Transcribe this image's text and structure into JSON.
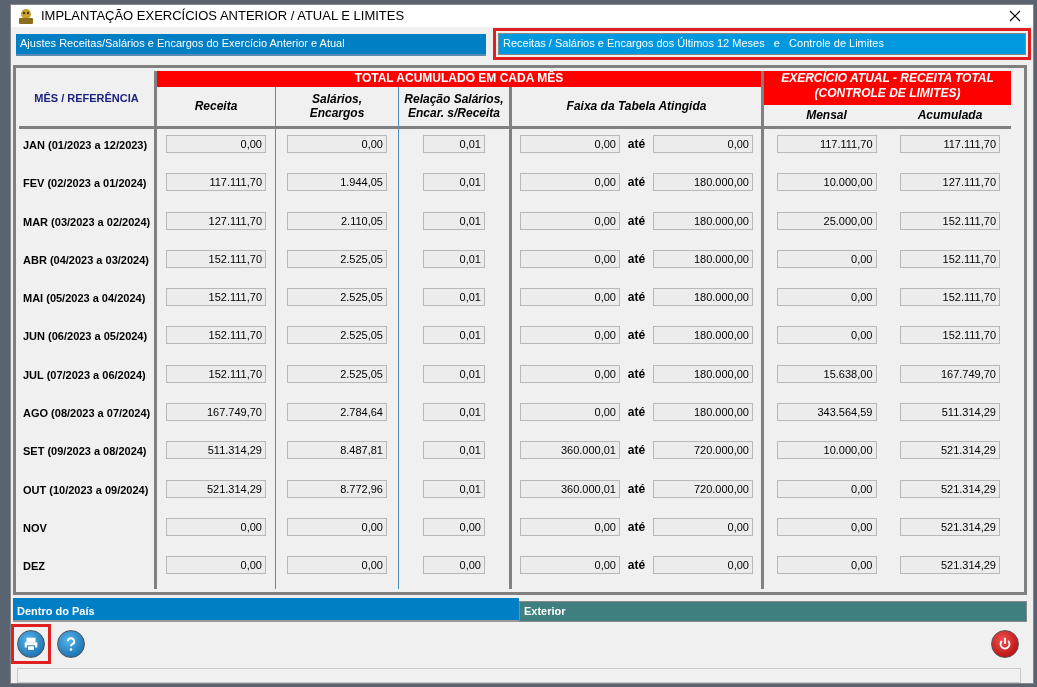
{
  "window": {
    "title": "IMPLANTAÇÃO EXERCÍCIOS ANTERIOR / ATUAL E LIMITES"
  },
  "tabs": [
    {
      "label": "Ajustes Receitas/Salários e Encargos do Exercício Anterior e Atual",
      "selected": false,
      "highlighted": false
    },
    {
      "label": "Receitas / Salários e Encargos dos Últimos 12 Meses   e   Controle de Limites",
      "selected": true,
      "highlighted": true
    }
  ],
  "table": {
    "month_header": "MÊS / REFERÊNCIA",
    "group_header": "TOTAL ACUMULADO EM CADA MÊS",
    "limits_header": "EXERCÍCIO ATUAL - RECEITA TOTAL (CONTROLE DE LIMITES)",
    "columns": [
      "Receita",
      "Salários, Encargos",
      "Relação Salários, Encar. s/Receita",
      "Faixa da Tabela Atingida",
      "Mensal",
      "Acumulada"
    ],
    "rows": [
      {
        "month": "JAN  (01/2023 a 12/2023)",
        "receita": "0,00",
        "salarios": "0,00",
        "relacao": "0,01",
        "faixa_de": "0,00",
        "ate": "até",
        "faixa_ate": "0,00",
        "mensal": "117.111,70",
        "acumulada": "117.111,70"
      },
      {
        "month": "FEV  (02/2023 a 01/2024)",
        "receita": "117.111,70",
        "salarios": "1.944,05",
        "relacao": "0,01",
        "faixa_de": "0,00",
        "ate": "até",
        "faixa_ate": "180.000,00",
        "mensal": "10.000,00",
        "acumulada": "127.111,70"
      },
      {
        "month": "MAR  (03/2023 a 02/2024)",
        "receita": "127.111,70",
        "salarios": "2.110,05",
        "relacao": "0,01",
        "faixa_de": "0,00",
        "ate": "até",
        "faixa_ate": "180.000,00",
        "mensal": "25.000,00",
        "acumulada": "152.111,70"
      },
      {
        "month": "ABR  (04/2023 a 03/2024)",
        "receita": "152.111,70",
        "salarios": "2.525,05",
        "relacao": "0,01",
        "faixa_de": "0,00",
        "ate": "até",
        "faixa_ate": "180.000,00",
        "mensal": "0,00",
        "acumulada": "152.111,70"
      },
      {
        "month": "MAI  (05/2023 a 04/2024)",
        "receita": "152.111,70",
        "salarios": "2.525,05",
        "relacao": "0,01",
        "faixa_de": "0,00",
        "ate": "até",
        "faixa_ate": "180.000,00",
        "mensal": "0,00",
        "acumulada": "152.111,70"
      },
      {
        "month": "JUN  (06/2023 a 05/2024)",
        "receita": "152.111,70",
        "salarios": "2.525,05",
        "relacao": "0,01",
        "faixa_de": "0,00",
        "ate": "até",
        "faixa_ate": "180.000,00",
        "mensal": "0,00",
        "acumulada": "152.111,70"
      },
      {
        "month": "JUL  (07/2023 a 06/2024)",
        "receita": "152.111,70",
        "salarios": "2.525,05",
        "relacao": "0,01",
        "faixa_de": "0,00",
        "ate": "até",
        "faixa_ate": "180.000,00",
        "mensal": "15.638,00",
        "acumulada": "167.749,70"
      },
      {
        "month": "AGO  (08/2023 a 07/2024)",
        "receita": "167.749,70",
        "salarios": "2.784,64",
        "relacao": "0,01",
        "faixa_de": "0,00",
        "ate": "até",
        "faixa_ate": "180.000,00",
        "mensal": "343.564,59",
        "acumulada": "511.314,29"
      },
      {
        "month": "SET  (09/2023 a 08/2024)",
        "receita": "511.314,29",
        "salarios": "8.487,81",
        "relacao": "0,01",
        "faixa_de": "360.000,01",
        "ate": "até",
        "faixa_ate": "720.000,00",
        "mensal": "10.000,00",
        "acumulada": "521.314,29"
      },
      {
        "month": "OUT  (10/2023 a 09/2024)",
        "receita": "521.314,29",
        "salarios": "8.772,96",
        "relacao": "0,01",
        "faixa_de": "360.000,01",
        "ate": "até",
        "faixa_ate": "720.000,00",
        "mensal": "0,00",
        "acumulada": "521.314,29"
      },
      {
        "month": "NOV",
        "receita": "0,00",
        "salarios": "0,00",
        "relacao": "0,00",
        "faixa_de": "0,00",
        "ate": "até",
        "faixa_ate": "0,00",
        "mensal": "0,00",
        "acumulada": "521.314,29"
      },
      {
        "month": "DEZ",
        "receita": "0,00",
        "salarios": "0,00",
        "relacao": "0,00",
        "faixa_de": "0,00",
        "ate": "até",
        "faixa_ate": "0,00",
        "mensal": "0,00",
        "acumulada": "521.314,29"
      }
    ]
  },
  "bottom_tabs": [
    {
      "label": "Dentro do País",
      "selected": true
    },
    {
      "label": "Exterior",
      "selected": false
    }
  ],
  "buttons": [
    {
      "kind": "print",
      "highlighted": true
    },
    {
      "kind": "help",
      "highlighted": false
    },
    {
      "kind": "power",
      "highlighted": false
    }
  ]
}
